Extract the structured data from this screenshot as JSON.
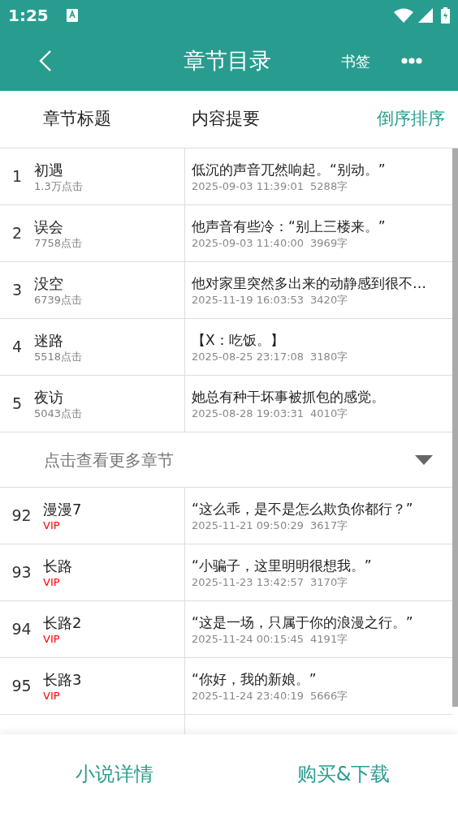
{
  "status_bar": {
    "time": "1:25"
  },
  "toolbar": {
    "title": "章节目录",
    "bookmark": "书签"
  },
  "table_header": {
    "column_title": "章节标题",
    "column_summary": "内容提要",
    "sort": "倒序排序"
  },
  "chapters_top": [
    {
      "number": "1",
      "title": "初遇",
      "kind": "free",
      "tag": "1.3万点击",
      "summary": "低沉的声音兀然响起。“别动。”",
      "date": "2025-09-03 11:39:01",
      "words": "5288字"
    },
    {
      "number": "2",
      "title": "误会",
      "kind": "free",
      "tag": "7758点击",
      "summary": "他声音有些冷：“别上三楼来。”",
      "date": "2025-09-03 11:40:00",
      "words": "3969字"
    },
    {
      "number": "3",
      "title": "没空",
      "kind": "free",
      "tag": "6739点击",
      "summary": "他对家里突然多出来的动静感到很不…",
      "date": "2025-11-19 16:03:53",
      "words": "3420字"
    },
    {
      "number": "4",
      "title": "迷路",
      "kind": "free",
      "tag": "5518点击",
      "summary": "【X：吃饭。】",
      "date": "2025-08-25 23:17:08",
      "words": "3180字"
    },
    {
      "number": "5",
      "title": "夜访",
      "kind": "free",
      "tag": "5043点击",
      "summary": "她总有种干坏事被抓包的感觉。",
      "date": "2025-08-28 19:03:31",
      "words": "4010字"
    }
  ],
  "more": {
    "label": "点击查看更多章节",
    "expanded": false
  },
  "chapters_bottom": [
    {
      "number": "92",
      "title": "漫漫7",
      "kind": "vip",
      "tag": "VIP",
      "summary": "“这么乖，是不是怎么欺负你都行？”",
      "date": "2025-11-21 09:50:29",
      "words": "3617字"
    },
    {
      "number": "93",
      "title": "长路",
      "kind": "vip",
      "tag": "VIP",
      "summary": "“小骗子，这里明明很想我。”",
      "date": "2025-11-23 13:42:57",
      "words": "3170字"
    },
    {
      "number": "94",
      "title": "长路2",
      "kind": "vip",
      "tag": "VIP",
      "summary": "“这是一场，只属于你的浪漫之行。”",
      "date": "2025-11-24 00:15:45",
      "words": "4191字"
    },
    {
      "number": "95",
      "title": "长路3",
      "kind": "vip",
      "tag": "VIP",
      "summary": "“你好，我的新娘。”",
      "date": "2025-11-24 23:40:19",
      "words": "5666字"
    }
  ],
  "bottom_bar": {
    "details": "小说详情",
    "buy": "购买&下载"
  }
}
